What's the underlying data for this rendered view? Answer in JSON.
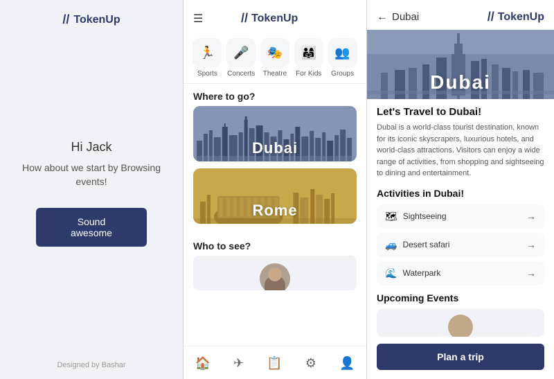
{
  "app": {
    "name": "TokenUp",
    "logo_symbol": "//",
    "designed_by": "Designed by Bashar"
  },
  "panel1": {
    "greeting": "Hi Jack",
    "sub_greeting": "How about we start by\nBrowsing events!",
    "cta_button": "Sound awesome"
  },
  "panel2": {
    "header_title": "TokenUp",
    "hamburger_label": "☰",
    "categories": [
      {
        "label": "Sports",
        "icon": "🏃"
      },
      {
        "label": "Concerts",
        "icon": "🎤"
      },
      {
        "label": "Theatre",
        "icon": "🎭"
      },
      {
        "label": "For Kids",
        "icon": "👨‍👩‍👧"
      },
      {
        "label": "Groups",
        "icon": "👥"
      }
    ],
    "where_to_go": "Where to go?",
    "cities": [
      {
        "name": "Dubai",
        "theme": "blue"
      },
      {
        "name": "Rome",
        "theme": "gold"
      }
    ],
    "who_to_see": "Who to see?",
    "nav_items": [
      "🏠",
      "✈",
      "📋",
      "⚙",
      "👤"
    ]
  },
  "panel3": {
    "back_label": "Dubai",
    "hero_city": "Dubai",
    "travel_title": "Let's Travel to Dubai!",
    "travel_desc": "Dubai is a world-class tourist destination, known for its iconic skyscrapers, luxurious hotels, and world-class attractions. Visitors can enjoy a wide range of activities, from shopping and sightseeing to dining and entertainment.",
    "activities_title": "Activities in Dubai!",
    "activities": [
      {
        "name": "Sightseeing",
        "icon": "🗺"
      },
      {
        "name": "Desert safari",
        "icon": "🚙"
      },
      {
        "name": "Waterpark",
        "icon": "🌊"
      }
    ],
    "upcoming_title": "Upcoming Events",
    "plan_trip_btn": "Plan a trip"
  }
}
